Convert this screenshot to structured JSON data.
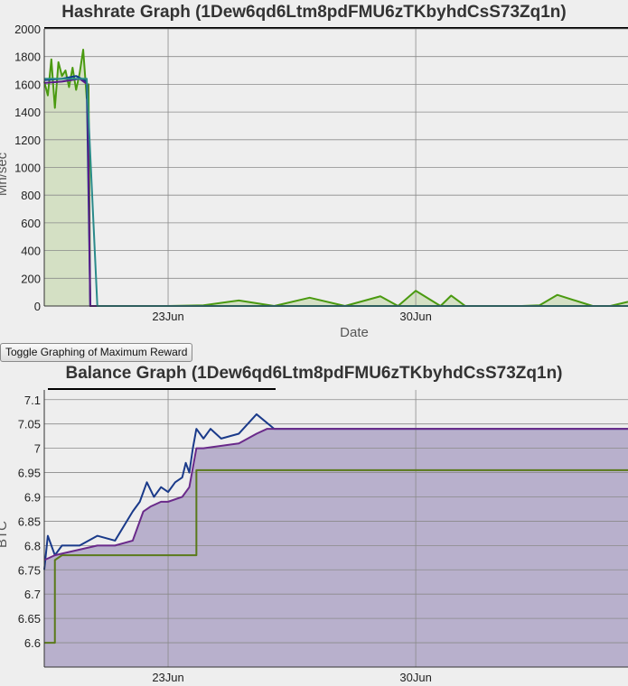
{
  "hashrate_chart": {
    "title": "Hashrate Graph (1Dew6qd6Ltm8pdFMU6zTKbyhdCsS73Zq1n)",
    "xlabel": "Date",
    "ylabel": "Mh/sec",
    "yticks": [
      "0",
      "200",
      "400",
      "600",
      "800",
      "1000",
      "1200",
      "1400",
      "1600",
      "1800",
      "2000"
    ],
    "xticks": [
      "23Jun",
      "30Jun"
    ]
  },
  "toggle_button": {
    "label": "Toggle Graphing of Maximum Reward"
  },
  "balance_chart": {
    "title": "Balance Graph (1Dew6qd6Ltm8pdFMU6zTKbyhdCsS73Zq1n)",
    "ylabel": "BTC",
    "yticks": [
      "6.6",
      "6.65",
      "6.7",
      "6.75",
      "6.8",
      "6.85",
      "6.9",
      "6.95",
      "7",
      "7.05",
      "7.1"
    ],
    "xticks": [
      "23Jun",
      "30Jun"
    ]
  },
  "chart_data": [
    {
      "type": "line",
      "title": "Hashrate Graph (1Dew6qd6Ltm8pdFMU6zTKbyhdCsS73Zq1n)",
      "xlabel": "Date",
      "ylabel": "Mh/sec",
      "xlim": [
        19.5,
        36.0
      ],
      "ylim": [
        0,
        2000
      ],
      "xticks": [
        {
          "label": "23Jun",
          "day": 23
        },
        {
          "label": "30Jun",
          "day": 30
        }
      ],
      "grid": true,
      "series": [
        {
          "color": "#4a9a10",
          "fill": "#d4e0c4",
          "x": [
            19.5,
            19.6,
            19.7,
            19.8,
            19.9,
            20.0,
            20.1,
            20.2,
            20.3,
            20.4,
            20.5,
            20.6,
            20.7,
            20.75,
            20.8,
            21.0,
            22.0,
            23.0,
            24.0,
            25.0,
            26.0,
            27.0,
            28.0,
            29.0,
            29.5,
            30.0,
            30.7,
            31.0,
            31.4,
            32.0,
            33.0,
            33.5,
            34.0,
            35.0,
            35.2,
            35.5,
            36.0
          ],
          "y": [
            1620,
            1520,
            1780,
            1430,
            1760,
            1660,
            1700,
            1580,
            1720,
            1560,
            1680,
            1850,
            1500,
            1600,
            0,
            0,
            0,
            0,
            5,
            40,
            0,
            60,
            0,
            70,
            0,
            110,
            0,
            75,
            0,
            0,
            0,
            5,
            80,
            0,
            0,
            0,
            30
          ]
        },
        {
          "color": "#0a3a8c",
          "x": [
            19.5,
            20.0,
            20.4,
            20.7,
            20.8,
            21.0,
            36.0
          ],
          "y": [
            1630,
            1640,
            1660,
            1620,
            0,
            0,
            0
          ]
        },
        {
          "color": "#5a1a8a",
          "x": [
            19.5,
            20.0,
            20.5,
            20.72,
            20.8,
            21.0,
            36.0
          ],
          "y": [
            1610,
            1620,
            1640,
            1600,
            0,
            0,
            0
          ]
        },
        {
          "color": "#2a8a8a",
          "x": [
            19.5,
            20.7,
            21.0,
            21.2,
            36.0
          ],
          "y": [
            1640,
            1640,
            0,
            0,
            0
          ]
        }
      ]
    },
    {
      "type": "area",
      "title": "Balance Graph (1Dew6qd6Ltm8pdFMU6zTKbyhdCsS73Zq1n)",
      "ylabel": "BTC",
      "xlim": [
        19.5,
        36.0
      ],
      "ylim": [
        6.55,
        7.12
      ],
      "xticks": [
        {
          "label": "23Jun",
          "day": 23
        },
        {
          "label": "30Jun",
          "day": 30
        }
      ],
      "grid": true,
      "series": [
        {
          "color": "#5a7a1a",
          "fill": "#9a9a9a",
          "x": [
            19.5,
            19.8,
            19.8,
            20.0,
            23.8,
            23.8,
            36.0
          ],
          "y": [
            6.6,
            6.6,
            6.77,
            6.78,
            6.78,
            6.955,
            6.955
          ]
        },
        {
          "color": "#1a3a8a",
          "x": [
            19.5,
            19.6,
            19.8,
            20.0,
            20.5,
            21.0,
            21.5,
            22.0,
            22.2,
            22.4,
            22.6,
            22.8,
            23.0,
            23.2,
            23.4,
            23.5,
            23.6,
            23.7,
            23.8,
            24.0,
            24.2,
            24.5,
            25.0,
            25.5,
            26.0,
            36.0
          ],
          "y": [
            6.75,
            6.82,
            6.78,
            6.8,
            6.8,
            6.82,
            6.81,
            6.87,
            6.89,
            6.93,
            6.9,
            6.92,
            6.91,
            6.93,
            6.94,
            6.97,
            6.95,
            7.0,
            7.04,
            7.02,
            7.04,
            7.02,
            7.03,
            7.07,
            7.04,
            7.04
          ]
        },
        {
          "color": "#6a2a8a",
          "fill": "#b8b0cc",
          "x": [
            19.5,
            19.8,
            20.4,
            21.0,
            21.5,
            22.0,
            22.3,
            22.5,
            22.8,
            23.0,
            23.4,
            23.6,
            23.8,
            24.0,
            25.0,
            25.5,
            25.8,
            36.0
          ],
          "y": [
            6.77,
            6.78,
            6.79,
            6.8,
            6.8,
            6.81,
            6.87,
            6.88,
            6.89,
            6.89,
            6.9,
            6.92,
            7.0,
            7.0,
            7.01,
            7.03,
            7.04,
            7.04
          ]
        }
      ]
    }
  ]
}
